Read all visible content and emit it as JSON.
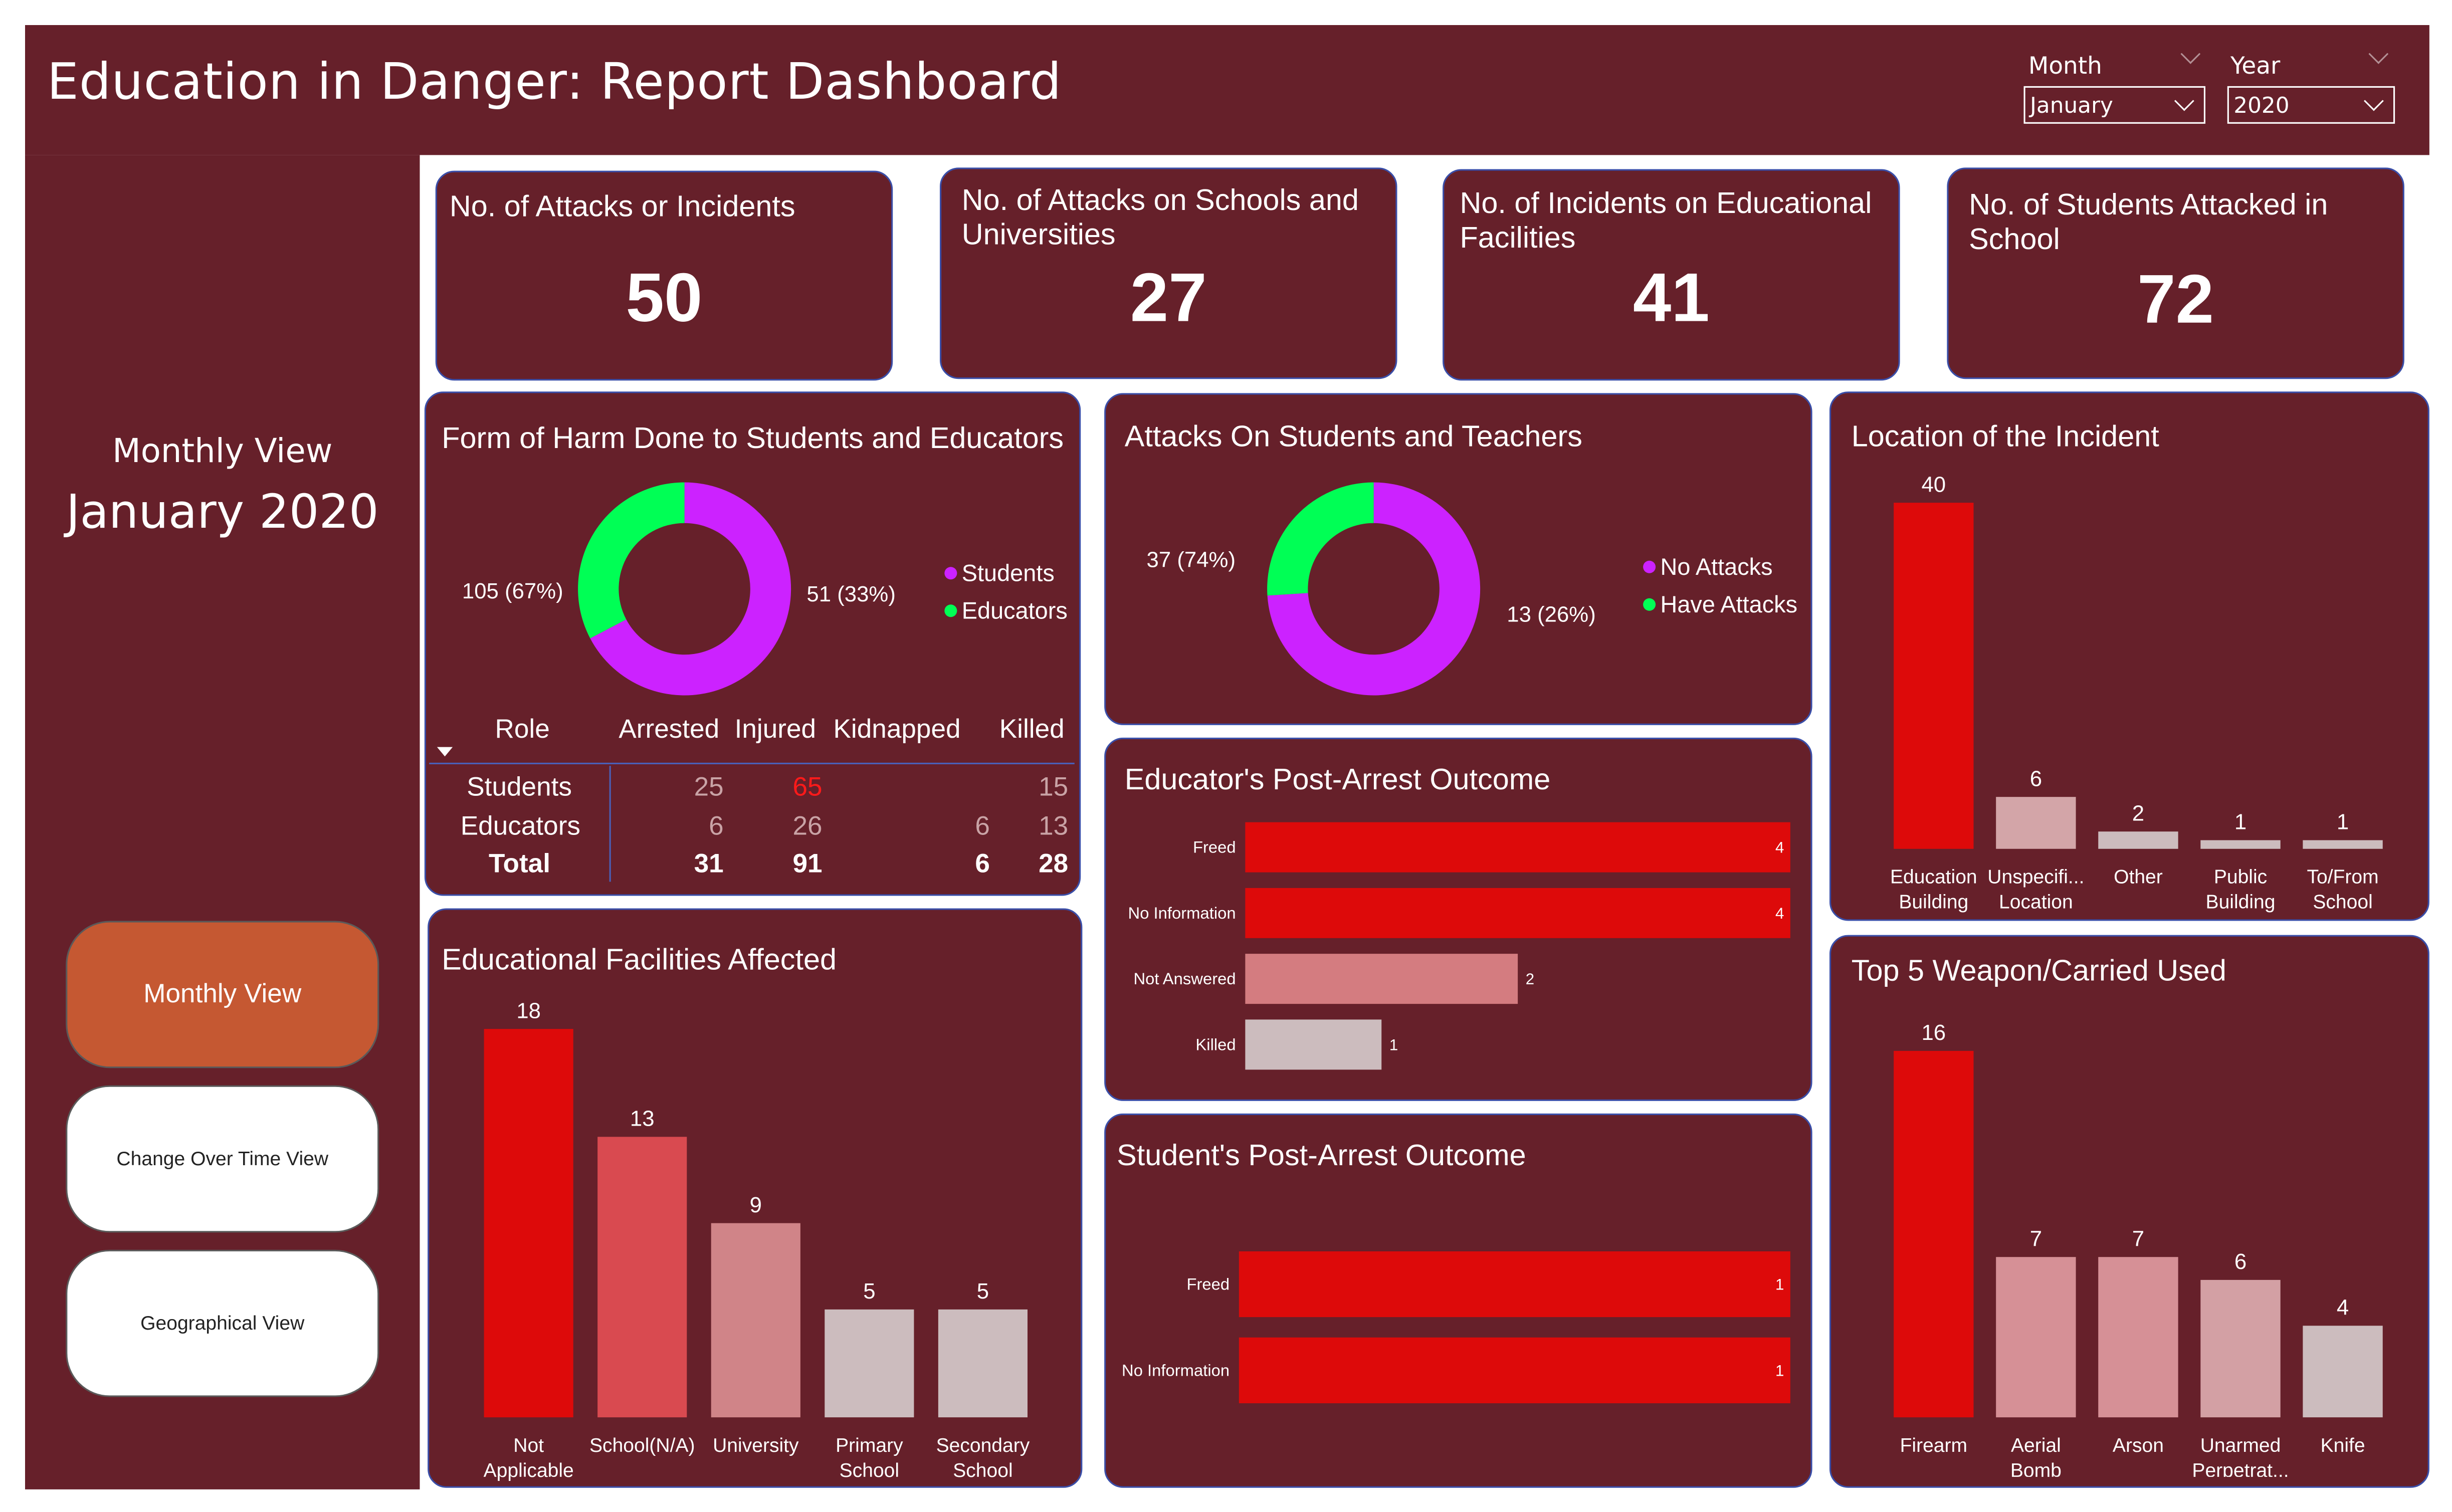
{
  "header": {
    "title": "Education in Danger: Report Dashboard"
  },
  "filters": {
    "month": {
      "label": "Month",
      "value": "January"
    },
    "year": {
      "label": "Year",
      "value": "2020"
    }
  },
  "sidebar": {
    "view_label": "Monthly View",
    "period_label": "January 2020",
    "buttons": [
      {
        "label": "Monthly View",
        "active": true
      },
      {
        "label": "Change Over Time View",
        "active": false
      },
      {
        "label": "Geographical View",
        "active": false
      }
    ]
  },
  "kpis": [
    {
      "title": "No. of Attacks or Incidents",
      "value": "50"
    },
    {
      "title": "No. of Attacks on Schools and Universities",
      "value": "27"
    },
    {
      "title": "No. of Incidents on Educational Facilities",
      "value": "41"
    },
    {
      "title": "No. of Students Attacked in School",
      "value": "72"
    }
  ],
  "harm_panel": {
    "title": "Form of Harm Done to Students and Educators",
    "donut_left": "105 (67%)",
    "donut_right": "51 (33%)",
    "legend": [
      "Students",
      "Educators"
    ],
    "table": {
      "headers": [
        "Role",
        "Arrested",
        "Injured",
        "Kidnapped",
        "Killed"
      ],
      "rows": [
        {
          "role": "Students",
          "arrested": "25",
          "injured": "65",
          "kidnapped": "",
          "killed": "15"
        },
        {
          "role": "Educators",
          "arrested": "6",
          "injured": "26",
          "kidnapped": "6",
          "killed": "13"
        }
      ],
      "total": {
        "role": "Total",
        "arrested": "31",
        "injured": "91",
        "kidnapped": "6",
        "killed": "28"
      }
    }
  },
  "attacks_panel": {
    "title": "Attacks On Students and Teachers",
    "donut_left": "37 (74%)",
    "donut_right": "13 (26%)",
    "legend": [
      "No Attacks",
      "Have Attacks"
    ]
  },
  "educator_panel": {
    "title": "Educator's Post-Arrest Outcome"
  },
  "student_panel": {
    "title": "Student's Post-Arrest Outcome"
  },
  "facilities_panel": {
    "title": "Educational Facilities Affected"
  },
  "location_panel": {
    "title": "Location of the Incident"
  },
  "weapons_panel": {
    "title": "Top 5 Weapon/Carried Used"
  },
  "colors": {
    "background": "#66202a",
    "students": "#cc22ff",
    "educators": "#00ff55",
    "bar_primary": "#dd0a0a",
    "bar_light": "#ccbcbe"
  },
  "chart_data": [
    {
      "id": "harm_donut",
      "type": "pie",
      "categories": [
        "Students",
        "Educators"
      ],
      "values": [
        105,
        51
      ],
      "colors": [
        "#cc22ff",
        "#00ff55"
      ]
    },
    {
      "id": "attacks_donut",
      "type": "pie",
      "categories": [
        "No Attacks",
        "Have Attacks"
      ],
      "values": [
        37,
        13
      ],
      "colors": [
        "#cc22ff",
        "#00ff55"
      ]
    },
    {
      "id": "educator_outcome",
      "type": "bar",
      "orientation": "horizontal",
      "categories": [
        "Freed",
        "No Information",
        "Not Answered",
        "Killed"
      ],
      "values": [
        4,
        4,
        2,
        1
      ],
      "colors": [
        "#dd0a0a",
        "#dd0a0a",
        "#d47c80",
        "#ccbcbe"
      ],
      "xlim": [
        0,
        4
      ]
    },
    {
      "id": "student_outcome",
      "type": "bar",
      "orientation": "horizontal",
      "categories": [
        "Freed",
        "No Information"
      ],
      "values": [
        1,
        1
      ],
      "colors": [
        "#dd0a0a",
        "#dd0a0a"
      ],
      "xlim": [
        0,
        1
      ]
    },
    {
      "id": "facilities",
      "type": "bar",
      "categories": [
        "Not Applicable",
        "School(N/A)",
        "University",
        "Primary School",
        "Secondary School"
      ],
      "values": [
        18,
        13,
        9,
        5,
        5
      ],
      "colors": [
        "#dd0a0a",
        "#d94a50",
        "#d08488",
        "#ccbcbe",
        "#ccbcbe"
      ],
      "ylim": [
        0,
        18
      ]
    },
    {
      "id": "location",
      "type": "bar",
      "categories": [
        "Education Building",
        "Unspecifi... Location",
        "Other",
        "Public Building",
        "To/From School"
      ],
      "values": [
        40,
        6,
        2,
        1,
        1
      ],
      "colors": [
        "#dd0a0a",
        "#d3a5a8",
        "#ccbcbe",
        "#ccbcbe",
        "#ccbcbe"
      ],
      "ylim": [
        0,
        40
      ]
    },
    {
      "id": "weapons",
      "type": "bar",
      "categories": [
        "Firearm",
        "Aerial Bomb",
        "Arson",
        "Unarmed Perpetrat...",
        "Knife"
      ],
      "values": [
        16,
        7,
        7,
        6,
        4
      ],
      "colors": [
        "#dd0a0a",
        "#d69096",
        "#d69096",
        "#d3a0a4",
        "#ccbcbe"
      ],
      "ylim": [
        0,
        16
      ]
    }
  ]
}
